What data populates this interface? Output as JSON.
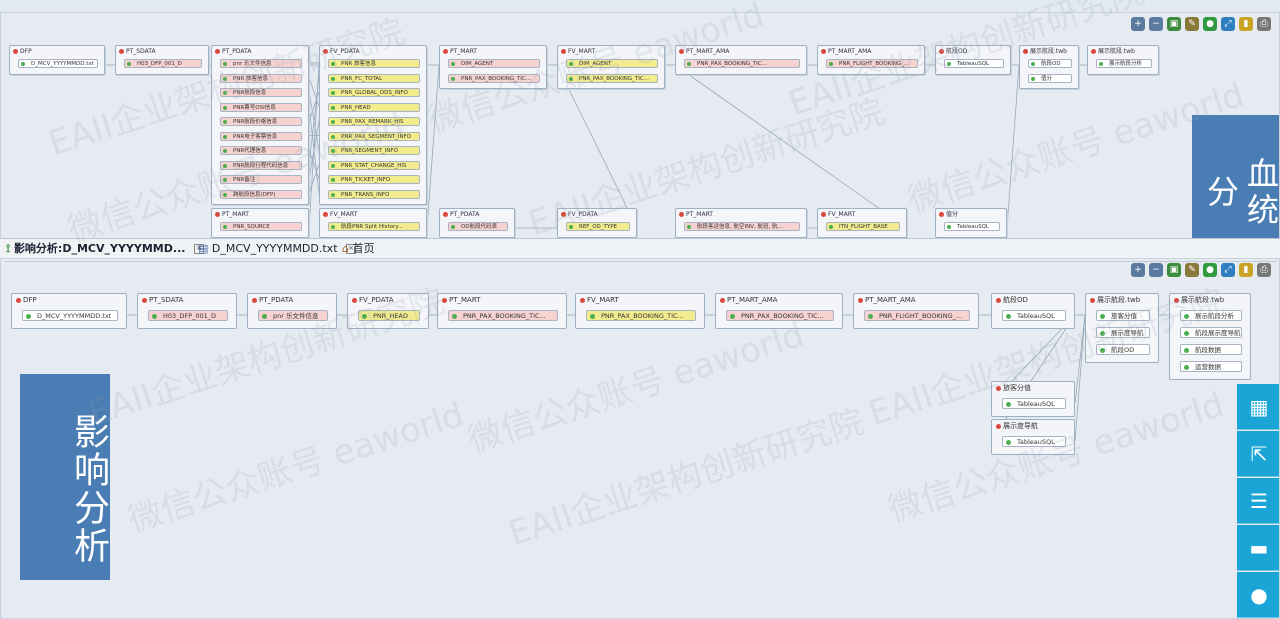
{
  "top": {
    "toolbar_icons": [
      "zoom-in-icon",
      "zoom-out-icon",
      "fit-icon",
      "wrench-icon",
      "globe-icon",
      "expand-icon",
      "bookmark-icon",
      "print-icon"
    ],
    "nodes": [
      {
        "title": "DFP",
        "items": [
          {
            "label": "D_MCV_YYYYMMDD.txt",
            "color": "white"
          }
        ]
      },
      {
        "title": "PT_SDATA",
        "items": [
          {
            "label": "H03_DFP_001_D",
            "color": "pink"
          }
        ]
      },
      {
        "title": "PT_PDATA",
        "items": [
          {
            "label": "pnr 乐文件信息",
            "color": "pink"
          },
          {
            "label": "PNR 旅客信息",
            "color": "pink"
          },
          {
            "label": "PNR航段信息",
            "color": "pink"
          },
          {
            "label": "PNR票号OSI信息",
            "color": "pink"
          },
          {
            "label": "PNR航段价格信息",
            "color": "pink"
          },
          {
            "label": "PNR电子客票信息",
            "color": "pink"
          },
          {
            "label": "PNR代理信息",
            "color": "pink"
          },
          {
            "label": "PNR航段行程代码信息",
            "color": "pink"
          },
          {
            "label": "PNR备注",
            "color": "pink"
          },
          {
            "label": "跨航段信息(DFP)",
            "color": "pink"
          }
        ]
      },
      {
        "title": "FV_PDATA",
        "items": [
          {
            "label": "PNR 旅客信息",
            "color": "yellow"
          },
          {
            "label": "PNR_FC_TOTAL",
            "color": "yellow"
          },
          {
            "label": "PNR_GLOBAL_ODS_INFO",
            "color": "yellow"
          },
          {
            "label": "PNR_HEAD",
            "color": "yellow"
          },
          {
            "label": "PNR_PAX_REMARK_HIS",
            "color": "yellow"
          },
          {
            "label": "PNR_PAX_SEGMENT_INFO",
            "color": "yellow"
          },
          {
            "label": "PNR_SEGMENT_INFO",
            "color": "yellow"
          },
          {
            "label": "PNR_STAT_CHANGE_HIS",
            "color": "yellow"
          },
          {
            "label": "PNR_TICKET_INFO",
            "color": "yellow"
          },
          {
            "label": "PNR_TRANS_INFO",
            "color": "yellow"
          }
        ]
      },
      {
        "title": "PT_MART",
        "items": [
          {
            "label": "DIM_AGENT",
            "color": "pink"
          },
          {
            "label": "PNR_PAX_BOOKING_TIC...",
            "color": "pink"
          }
        ]
      },
      {
        "title": "FV_MART",
        "items": [
          {
            "label": "DIM_AGENT",
            "color": "yellow"
          },
          {
            "label": "PNR_PAX_BOOKING_TIC...",
            "color": "yellow"
          }
        ]
      },
      {
        "title": "PT_MART_AMA",
        "items": [
          {
            "label": "PNR_PAX_BOOKING_TIC...",
            "color": "pink"
          }
        ]
      },
      {
        "title": "PT_MART_AMA",
        "items": [
          {
            "label": "PNR_FLIGHT_BOOKING_...",
            "color": "pink"
          }
        ]
      },
      {
        "title": "航段OD",
        "items": [
          {
            "label": "TableauSQL",
            "color": "white"
          }
        ]
      },
      {
        "title": "展示航段.twb",
        "items": [
          {
            "label": "航段OD",
            "color": "white"
          },
          {
            "label": "值分",
            "color": "white"
          }
        ]
      },
      {
        "title": "展示航段.twb",
        "items": [
          {
            "label": "展示航段分析",
            "color": "white"
          }
        ]
      },
      {
        "title": "PT_MART",
        "items": [
          {
            "label": "PNR_SOURCE",
            "color": "pink"
          }
        ]
      },
      {
        "title": "FV_MART",
        "items": [
          {
            "label": "航段PNR Split History...",
            "color": "yellow"
          }
        ]
      },
      {
        "title": "PT_PDATA",
        "items": [
          {
            "label": "OD航段代码表",
            "color": "pink"
          }
        ]
      },
      {
        "title": "FV_PDATA",
        "items": [
          {
            "label": "REF_OD_TYPE",
            "color": "yellow"
          }
        ]
      },
      {
        "title": "PT_MART",
        "items": [
          {
            "label": "航段客运信息, 航空INV, 航班, 航...",
            "color": "pink"
          }
        ]
      },
      {
        "title": "FV_MART",
        "items": [
          {
            "label": "ITN_FLIGHT_BASE",
            "color": "yellow"
          }
        ]
      },
      {
        "title": "值分",
        "items": [
          {
            "label": "TableauSQL",
            "color": "white"
          }
        ]
      }
    ],
    "label": "血统分"
  },
  "tabs": [
    {
      "label": "影响分析:D_MCV_YYYYMMD...",
      "icon": "lineage-icon"
    },
    {
      "label": "D_MCV_YYYYMMDD.txt",
      "icon": "file-icon"
    },
    {
      "label": "首页",
      "icon": "home-icon"
    }
  ],
  "bottom": {
    "nodes": [
      {
        "title": "DFP",
        "items": [
          {
            "label": "D_MCV_YYYYMMDD.txt",
            "color": "white"
          }
        ]
      },
      {
        "title": "PT_SDATA",
        "items": [
          {
            "label": "H03_DFP_001_D",
            "color": "pink"
          }
        ]
      },
      {
        "title": "PT_PDATA",
        "items": [
          {
            "label": "pnr 乐文件信息",
            "color": "pink"
          }
        ]
      },
      {
        "title": "FV_PDATA",
        "items": [
          {
            "label": "PNR_HEAD",
            "color": "yellow"
          }
        ]
      },
      {
        "title": "PT_MART",
        "items": [
          {
            "label": "PNR_PAX_BOOKING_TIC...",
            "color": "pink"
          }
        ]
      },
      {
        "title": "FV_MART",
        "items": [
          {
            "label": "PNR_PAX_BOOKING_TIC...",
            "color": "yellow"
          }
        ]
      },
      {
        "title": "PT_MART_AMA",
        "items": [
          {
            "label": "PNR_PAX_BOOKING_TIC...",
            "color": "pink"
          }
        ]
      },
      {
        "title": "PT_MART_AMA",
        "items": [
          {
            "label": "PNR_FLIGHT_BOOKING_...",
            "color": "pink"
          }
        ]
      },
      {
        "title": "航段OD",
        "items": [
          {
            "label": "TableauSQL",
            "color": "white"
          }
        ]
      },
      {
        "title": "展示航段.twb",
        "items": [
          {
            "label": "旅客分值",
            "color": "white"
          },
          {
            "label": "展示度导航",
            "color": "white"
          },
          {
            "label": "航段OD",
            "color": "white"
          }
        ]
      },
      {
        "title": "展示航段.twb",
        "items": [
          {
            "label": "展示航段分析",
            "color": "white"
          },
          {
            "label": "航段展示度导航",
            "color": "white"
          },
          {
            "label": "航段数据",
            "color": "white"
          },
          {
            "label": "运营数据",
            "color": "white"
          }
        ]
      },
      {
        "title": "旅客分值",
        "items": [
          {
            "label": "TableauSQL",
            "color": "white"
          }
        ]
      },
      {
        "title": "展示度导航",
        "items": [
          {
            "label": "TableauSQL",
            "color": "white"
          }
        ]
      }
    ],
    "label": "影响分析",
    "side_buttons": [
      "map-icon",
      "export-icon",
      "list-icon",
      "folder-icon",
      "user-icon"
    ]
  },
  "watermark": {
    "lines": [
      "EAII企业架构创新研究院",
      "微信公众账号 eaworld"
    ]
  }
}
